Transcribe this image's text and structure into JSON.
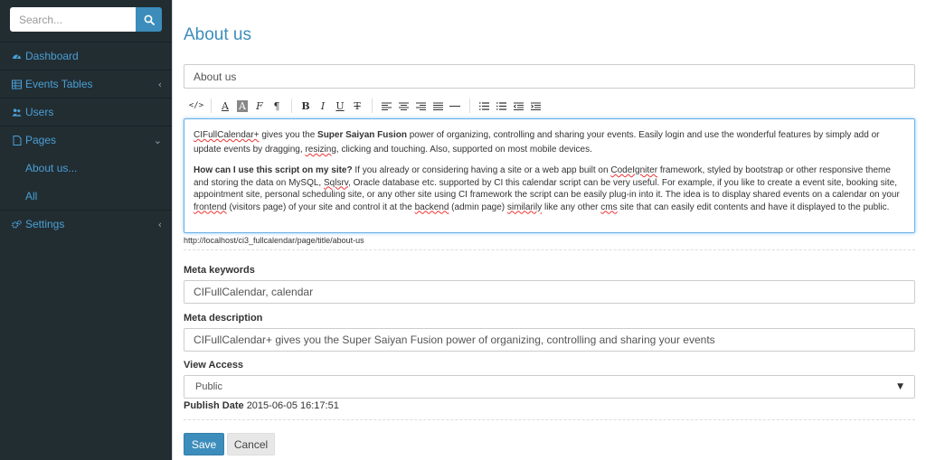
{
  "sidebar": {
    "search_placeholder": "Search...",
    "items": [
      {
        "label": "Dashboard",
        "icon": "dashboard-icon"
      },
      {
        "label": "Events Tables",
        "icon": "table-icon",
        "chevron": "‹"
      },
      {
        "label": "Users",
        "icon": "users-icon"
      },
      {
        "label": "Pages",
        "icon": "file-icon",
        "chevron": "⌄"
      },
      {
        "label": "Settings",
        "icon": "gears-icon",
        "chevron": "‹"
      }
    ],
    "sub_items": [
      {
        "label": "About us..."
      },
      {
        "label": "All"
      }
    ]
  },
  "main": {
    "page_title": "About us",
    "title_value": "About us",
    "editor": {
      "p1_a": "CIFullCalendar+",
      "p1_b": " gives you the ",
      "p1_bold": "Super Saiyan Fusion",
      "p1_c": " power of organizing, controlling and sharing your events. Easily login and use the wonderful features by simply add or update events by dragging, ",
      "p1_resizing": "resizing",
      "p1_d": ", clicking and touching. Also, supported on most mobile devices.",
      "p2_bold": "How can I use this script on my site?",
      "p2_a": " If you already or considering having a site or a web app built on ",
      "p2_codeigniter": "CodeIgniter",
      "p2_b": " framework, styled by bootstrap or other responsive theme and storing the data on MySQL, ",
      "p2_sqlsrv": "Sqlsrv",
      "p2_c": ", Oracle database etc. supported by CI this calendar script can be very useful. For example, if you like to create a event site, booking site, appointment site, personal scheduling site, or any other site using CI framework the script can be easily plug-in into it. The idea is to display shared events on a calendar on your ",
      "p2_frontend": "frontend",
      "p2_d": " (visitors page) of your site and control it at the ",
      "p2_backend": "backend",
      "p2_e": " (admin page) ",
      "p2_similarily": "similarily",
      "p2_f": " like any other ",
      "p2_cms": "cms",
      "p2_g": " site that can easily edit contents and have it displayed to the public."
    },
    "url": "http://localhost/ci3_fullcalendar/page/title/about-us",
    "meta_keywords_label": "Meta keywords",
    "meta_keywords_value": "CIFullCalendar, calendar",
    "meta_description_label": "Meta description",
    "meta_description_value": "CIFullCalendar+ gives you the Super Saiyan Fusion power of organizing, controlling and sharing your events",
    "view_access_label": "View Access",
    "view_access_value": "Public",
    "publish_date_label": "Publish Date",
    "publish_date_value": "2015-06-05 16:17:51",
    "save_label": "Save",
    "cancel_label": "Cancel"
  },
  "colors": {
    "sidebar_bg": "#222d32",
    "accent": "#3c8dbc",
    "link": "#4a9fd6"
  }
}
